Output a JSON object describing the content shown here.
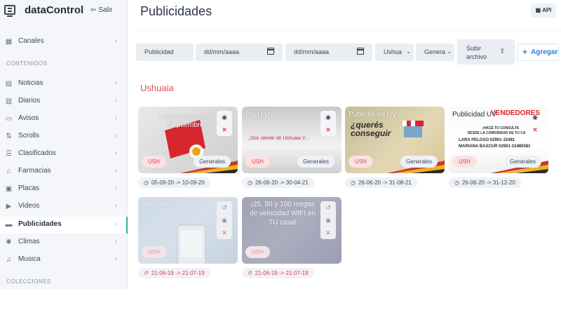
{
  "app": {
    "brand_name": "dataControl",
    "logout_label": "Salir",
    "api_label": "API"
  },
  "sidebar": {
    "top_items": [
      {
        "label": "Canales",
        "icon": "grid-icon"
      }
    ],
    "section_contenidos": "CONTENIDOS",
    "items": [
      {
        "label": "Noticias",
        "icon": "newspaper-icon"
      },
      {
        "label": "Diarios",
        "icon": "book-icon"
      },
      {
        "label": "Avisos",
        "icon": "notice-icon"
      },
      {
        "label": "Scrolls",
        "icon": "scroll-icon"
      },
      {
        "label": "Clasificados",
        "icon": "list-icon"
      },
      {
        "label": "Farmacias",
        "icon": "pharmacy-icon"
      },
      {
        "label": "Placas",
        "icon": "slides-icon"
      },
      {
        "label": "Videos",
        "icon": "video-icon"
      },
      {
        "label": "Publicidades",
        "icon": "ad-icon",
        "active": true
      },
      {
        "label": "Climas",
        "icon": "sun-icon"
      },
      {
        "label": "Musica",
        "icon": "music-icon"
      }
    ],
    "section_colecciones": "COLECCIONES"
  },
  "main": {
    "title": "Publicidades",
    "filters": {
      "publicidad_placeholder": "Publicidad",
      "date_from_placeholder": "dd/mm/aaaa",
      "date_to_placeholder": "dd/mm/aaaa",
      "city_value": "Ushua",
      "category_value": "Genera",
      "upload_label": "Subir archivo",
      "add_label": "Agregar"
    },
    "city_heading": "Ushuaia",
    "cards": [
      {
        "title": "Horario Especial Septiembre",
        "tag": "USH",
        "category": "Generales",
        "dates": "05-09-20 -> 10-09-20",
        "expired": false
      },
      {
        "title": "PayU UV",
        "subtitle": "¡Sos cliente de Ushuaia V...",
        "tag": "USH",
        "category": "Generales",
        "dates": "26-06-20 -> 30-04-21",
        "expired": false
      },
      {
        "title": "Publicite en UV",
        "subtitle": "¿querés conseguir",
        "tag": "USH",
        "category": "Generales",
        "dates": "26-06-20 -> 31-08-21",
        "expired": false
      },
      {
        "title": "Publicidad UV",
        "subtitle": "VENDEDORES",
        "body": [
          "¡HACÉ TU CONSULTA",
          "DESDE LA COMODIDAD DE TU CA",
          "LARA PELOSO 02901-15481",
          "MARIANA BASCUR 02901-15489381"
        ],
        "tag": "USH",
        "category": "Generales",
        "dates": "26-06-20 -> 31-12-20",
        "expired": false
      },
      {
        "title": "APP INFO 3",
        "tag": "USH",
        "dates": "21-06-19 -> 21-07-19",
        "expired": true
      },
      {
        "title": "¡25, 50 y 100 megas de velocidad WIFI en TU casa!",
        "tag": "USH",
        "dates": "21-06-19 -> 21-07-19",
        "expired": true
      }
    ]
  },
  "colors": {
    "accent_blue": "#2f7ce3",
    "city_red": "#e15050",
    "active_marker": "#2fb59b"
  }
}
